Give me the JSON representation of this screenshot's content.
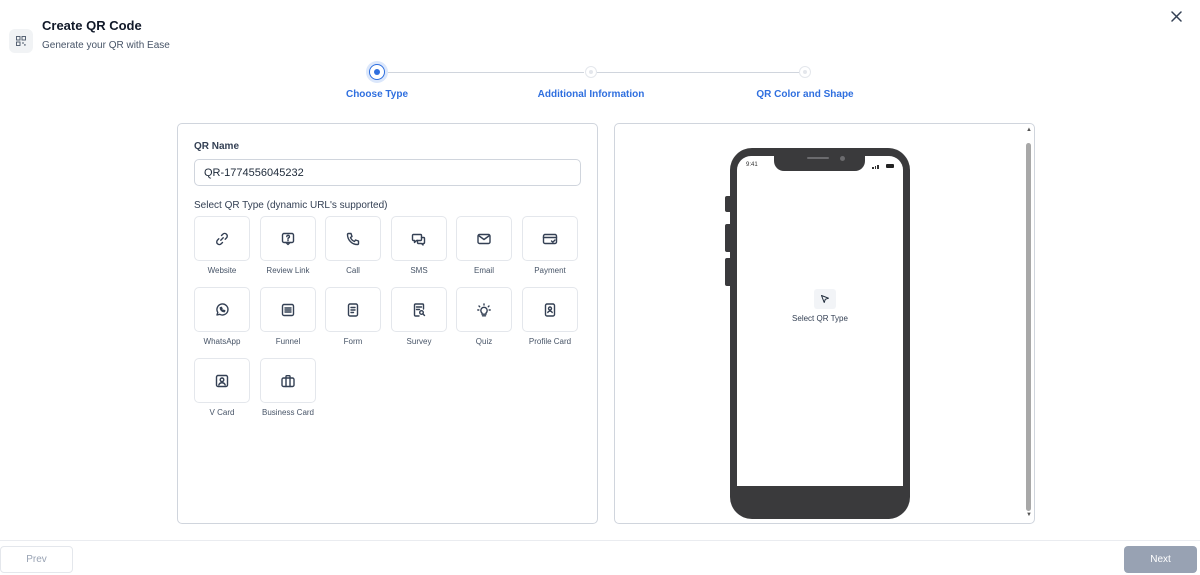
{
  "header": {
    "icon": "qr-icon",
    "title": "Create QR Code",
    "subtitle": "Generate your QR with Ease",
    "close_icon": "close-icon"
  },
  "stepper": {
    "steps": [
      {
        "label": "Choose Type",
        "state": "active"
      },
      {
        "label": "Additional Information",
        "state": "upcoming"
      },
      {
        "label": "QR Color and Shape",
        "state": "upcoming"
      }
    ],
    "accent_color": "#2f6fdf"
  },
  "form": {
    "name_label": "QR Name",
    "name_value": "QR-1774556045232",
    "type_label": "Select QR Type (dynamic URL's supported)",
    "types": [
      {
        "label": "Website",
        "icon": "link-icon"
      },
      {
        "label": "Review Link",
        "icon": "review-icon"
      },
      {
        "label": "Call",
        "icon": "phone-icon"
      },
      {
        "label": "SMS",
        "icon": "sms-icon"
      },
      {
        "label": "Email",
        "icon": "email-icon"
      },
      {
        "label": "Payment",
        "icon": "payment-icon"
      },
      {
        "label": "WhatsApp",
        "icon": "whatsapp-icon"
      },
      {
        "label": "Funnel",
        "icon": "funnel-icon"
      },
      {
        "label": "Form",
        "icon": "form-icon"
      },
      {
        "label": "Survey",
        "icon": "survey-icon"
      },
      {
        "label": "Quiz",
        "icon": "quiz-icon"
      },
      {
        "label": "Profile Card",
        "icon": "profile-card-icon"
      },
      {
        "label": "V Card",
        "icon": "vcard-icon"
      },
      {
        "label": "Business Card",
        "icon": "business-card-icon"
      }
    ]
  },
  "preview": {
    "status_time": "9:41",
    "placeholder_icon": "cursor-icon",
    "placeholder_text": "Select QR Type"
  },
  "footer": {
    "prev_label": "Prev",
    "next_label": "Next"
  }
}
